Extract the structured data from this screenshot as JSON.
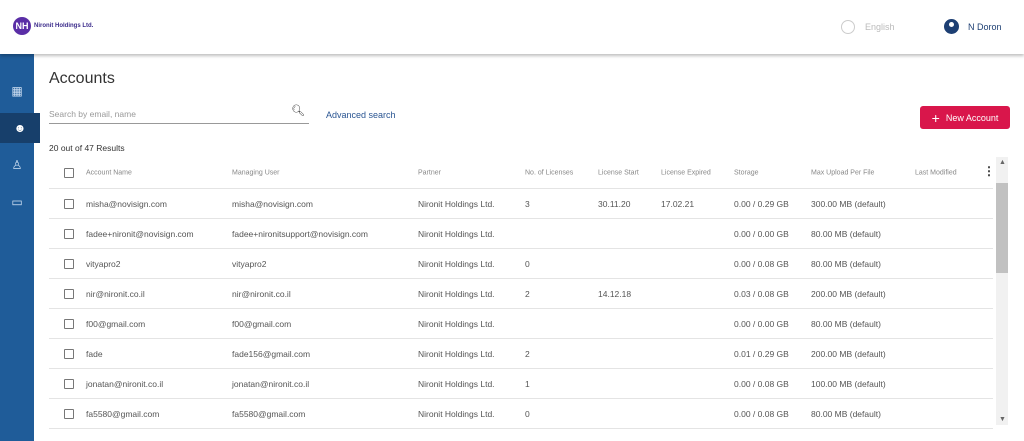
{
  "header": {
    "logo_text": "Nironit Holdings Ltd.",
    "logo_initials": "NH",
    "language": "English",
    "user": "N Doron"
  },
  "sidebar": {
    "items": [
      "dashboard",
      "accounts",
      "users",
      "folders"
    ]
  },
  "page": {
    "title": "Accounts",
    "search_placeholder": "Search by email, name",
    "advanced_search": "Advanced search",
    "new_account": "New Account",
    "results": "20 out of 47 Results"
  },
  "table": {
    "columns": [
      "Account Name",
      "Managing User",
      "Partner",
      "No. of Licenses",
      "License Start",
      "License Expired",
      "Storage",
      "Max Upload Per File",
      "Last Modified"
    ],
    "rows": [
      [
        "misha@novisign.com",
        "misha@novisign.com",
        "Nironit Holdings Ltd.",
        "3",
        "30.11.20",
        "17.02.21",
        "0.00 / 0.29 GB",
        "300.00 MB (default)",
        ""
      ],
      [
        "fadee+nironit@novisign.com",
        "fadee+nironitsupport@novisign.com",
        "Nironit Holdings Ltd.",
        "",
        "",
        "",
        "0.00 / 0.00 GB",
        "80.00 MB (default)",
        ""
      ],
      [
        "vityapro2",
        "vityapro2",
        "Nironit Holdings Ltd.",
        "0",
        "",
        "",
        "0.00 / 0.08 GB",
        "80.00 MB (default)",
        ""
      ],
      [
        "nir@nironit.co.il",
        "nir@nironit.co.il",
        "Nironit Holdings Ltd.",
        "2",
        "14.12.18",
        "",
        "0.03 / 0.08 GB",
        "200.00 MB (default)",
        ""
      ],
      [
        "f00@gmail.com",
        "f00@gmail.com",
        "Nironit Holdings Ltd.",
        "",
        "",
        "",
        "0.00 / 0.00 GB",
        "80.00 MB (default)",
        ""
      ],
      [
        "fade",
        "fade156@gmail.com",
        "Nironit Holdings Ltd.",
        "2",
        "",
        "",
        "0.01 / 0.29 GB",
        "200.00 MB (default)",
        ""
      ],
      [
        "jonatan@nironit.co.il",
        "jonatan@nironit.co.il",
        "Nironit Holdings Ltd.",
        "1",
        "",
        "",
        "0.00 / 0.08 GB",
        "100.00 MB (default)",
        ""
      ],
      [
        "fa5580@gmail.com",
        "fa5580@gmail.com",
        "Nironit Holdings Ltd.",
        "0",
        "",
        "",
        "0.00 / 0.08 GB",
        "80.00 MB (default)",
        ""
      ]
    ]
  },
  "colors": {
    "sidebar": "#1f5c99",
    "accent": "#d9164b",
    "link": "#2a5592"
  }
}
